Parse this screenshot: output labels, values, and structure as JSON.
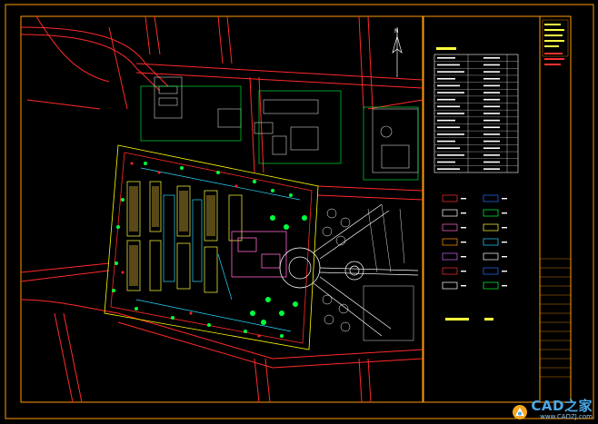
{
  "drawing": {
    "frame_color": "#ff9a00",
    "background_color": "#000000",
    "road_color": "#ff2a2a",
    "green_color": "#00ff3c",
    "building_color": "#ffffff"
  },
  "legend_table": {
    "rows": 17
  },
  "north_arrow": {
    "label": "N"
  },
  "watermark": {
    "brand": "CAD之家",
    "url": "www.CADZJ.com"
  }
}
